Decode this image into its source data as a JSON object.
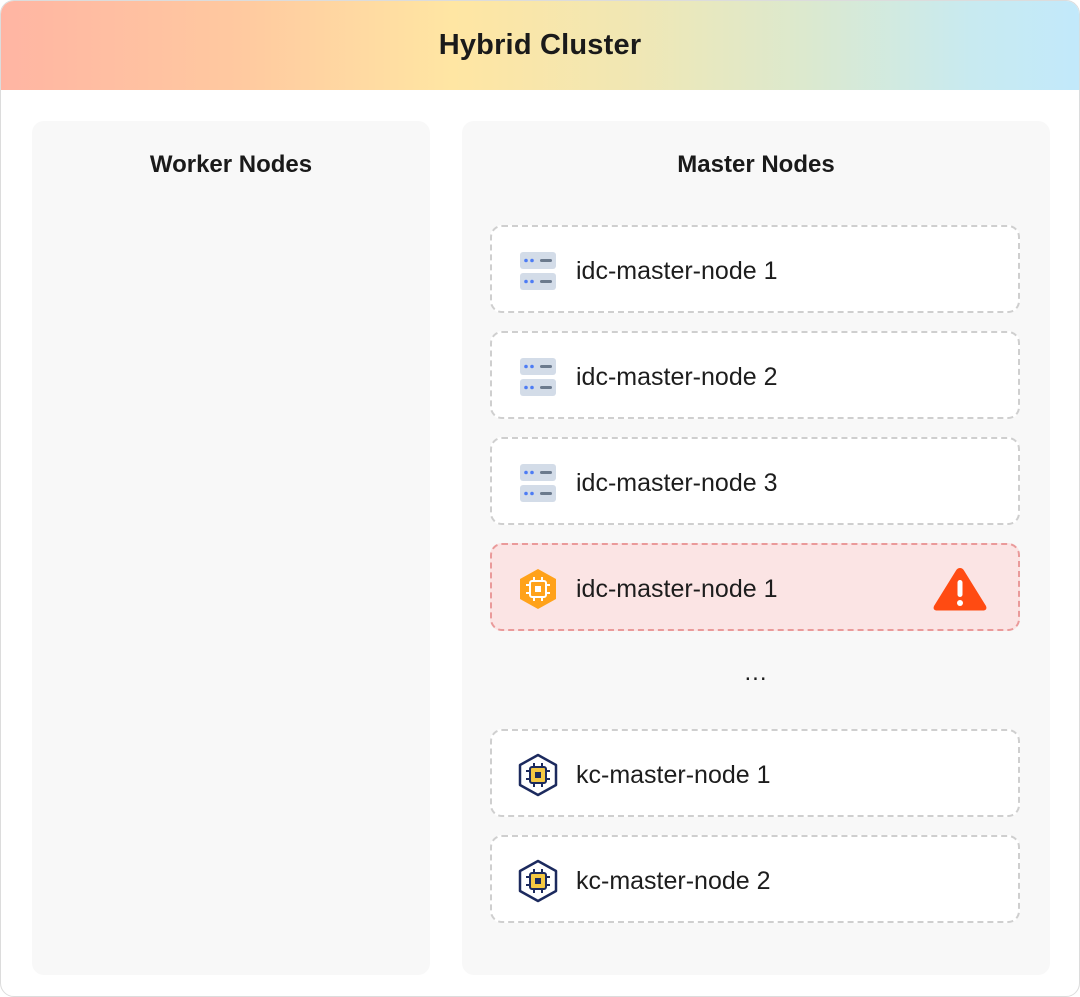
{
  "cluster": {
    "title": "Hybrid Cluster"
  },
  "worker_panel": {
    "title": "Worker Nodes"
  },
  "master_panel": {
    "title": "Master Nodes",
    "nodes": [
      {
        "label": "idc-master-node 1",
        "icon": "server-icon",
        "status": "normal"
      },
      {
        "label": "idc-master-node 2",
        "icon": "server-icon",
        "status": "normal"
      },
      {
        "label": "idc-master-node 3",
        "icon": "server-icon",
        "status": "normal"
      },
      {
        "label": "idc-master-node 1",
        "icon": "orange-chip-hexagon-icon",
        "status": "warning"
      },
      {
        "label": "kc-master-node 1",
        "icon": "chip-hexagon-icon",
        "status": "normal"
      },
      {
        "label": "kc-master-node 2",
        "icon": "chip-hexagon-icon",
        "status": "normal"
      }
    ],
    "ellipsis": "..."
  },
  "colors": {
    "alert_background": "#fbe4e4",
    "alert_border": "#ea9a9a",
    "warning": "#ff4b12",
    "chip_orange": "#ffa21a",
    "chip_navy": "#1c2a5e",
    "chip_yellow": "#f5c842"
  }
}
